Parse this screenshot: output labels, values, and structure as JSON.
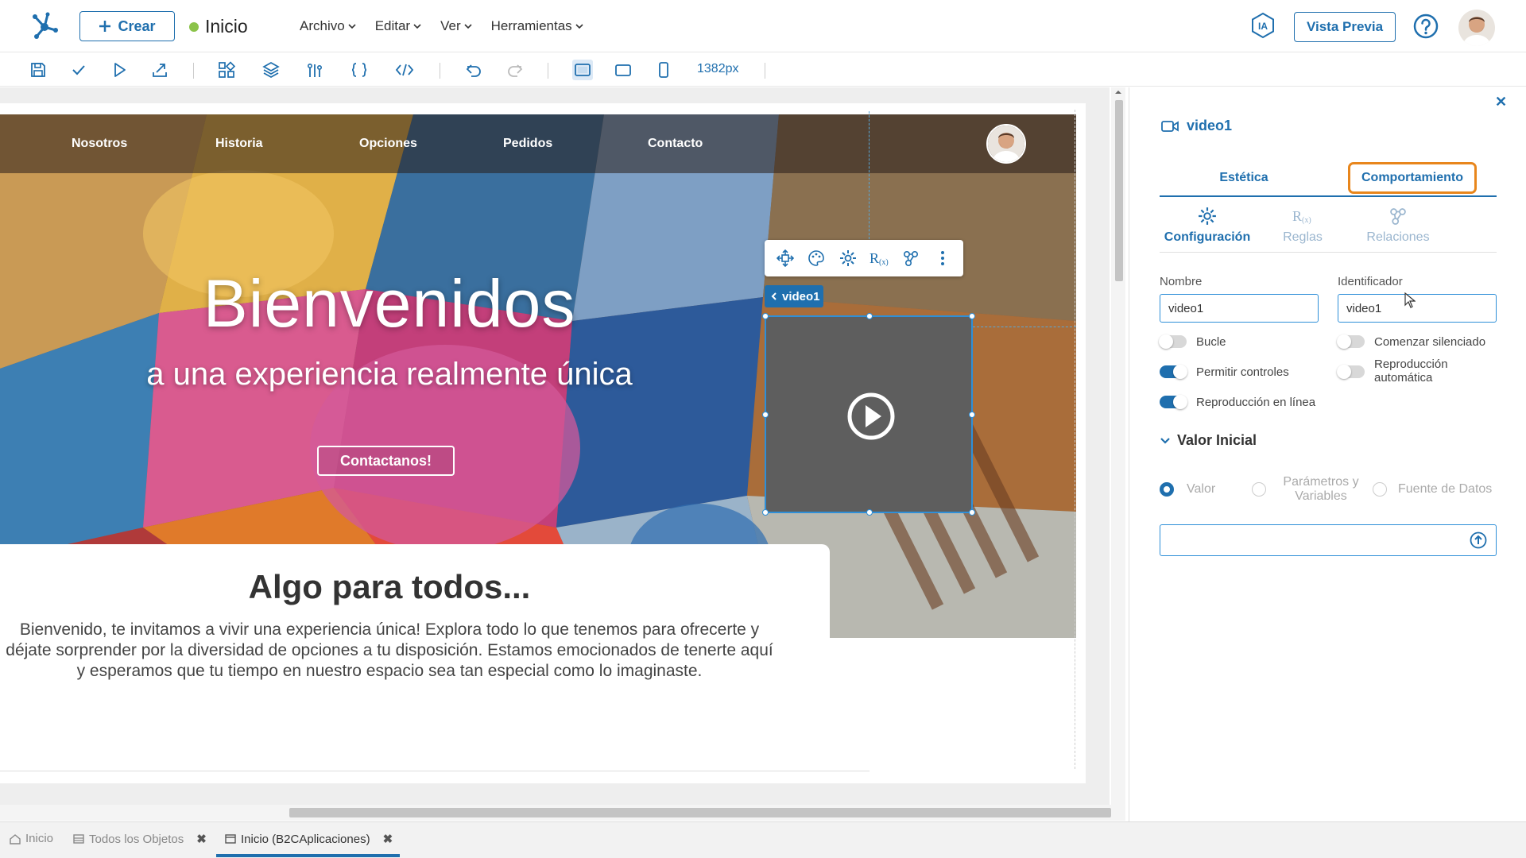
{
  "header": {
    "create_label": "Crear",
    "page_title": "Inicio",
    "menu": [
      "Archivo",
      "Editar",
      "Ver",
      "Herramientas"
    ],
    "ia_label": "IA",
    "preview_label": "Vista Previa"
  },
  "toolbar": {
    "icons": [
      "save-icon",
      "check-icon",
      "play-icon",
      "publish-icon",
      "components-icon",
      "layers-icon",
      "variables-icon",
      "braces-icon",
      "code-icon",
      "undo-icon",
      "redo-icon",
      "desktop-icon",
      "tablet-icon",
      "mobile-icon"
    ],
    "width_readout": "1382px"
  },
  "canvas": {
    "nav_links": [
      "Nosotros",
      "Historia",
      "Opciones",
      "Pedidos",
      "Contacto"
    ],
    "hero_title": "Bienvenidos",
    "hero_subtitle": "a una experiencia realmente única",
    "cta_label": "Contactanos!",
    "section_title": "Algo para todos...",
    "section_body": "Bienvenido, te invitamos a vivir una experiencia única! Explora todo lo que tenemos para ofrecerte y déjate sorprender por la diversidad de opciones a tu disposición. Estamos emocionados de tenerte aquí y esperamos que tu tiempo en nuestro espacio sea tan especial como lo imaginaste.",
    "selected_tag": "video1"
  },
  "panel": {
    "title": "video1",
    "tabs": [
      "Estética",
      "Comportamiento"
    ],
    "active_tab": "Comportamiento",
    "subtabs": [
      "Configuración",
      "Reglas",
      "Relaciones"
    ],
    "active_subtab": "Configuración",
    "fields": {
      "nombre_label": "Nombre",
      "nombre_value": "video1",
      "identificador_label": "Identificador",
      "identificador_value": "video1"
    },
    "toggles": [
      {
        "label": "Bucle",
        "on": false
      },
      {
        "label": "Comenzar silenciado",
        "on": false
      },
      {
        "label": "Permitir controles",
        "on": true
      },
      {
        "label": "Reproducción automática",
        "on": false
      },
      {
        "label": "Reproducción en línea",
        "on": true
      }
    ],
    "valor_inicial": {
      "header": "Valor Inicial",
      "options": [
        "Valor",
        "Parámetros y Variables",
        "Fuente de Datos"
      ],
      "selected": "Valor",
      "value": ""
    }
  },
  "bottom_tabs": [
    {
      "label": "Inicio",
      "closable": false
    },
    {
      "label": "Todos los Objetos",
      "closable": true
    },
    {
      "label": "Inicio (B2CAplicaciones)",
      "closable": true,
      "active": true
    }
  ],
  "colors": {
    "accent": "#1f6fae",
    "highlight": "#e8861c",
    "status": "#8bc34a"
  }
}
